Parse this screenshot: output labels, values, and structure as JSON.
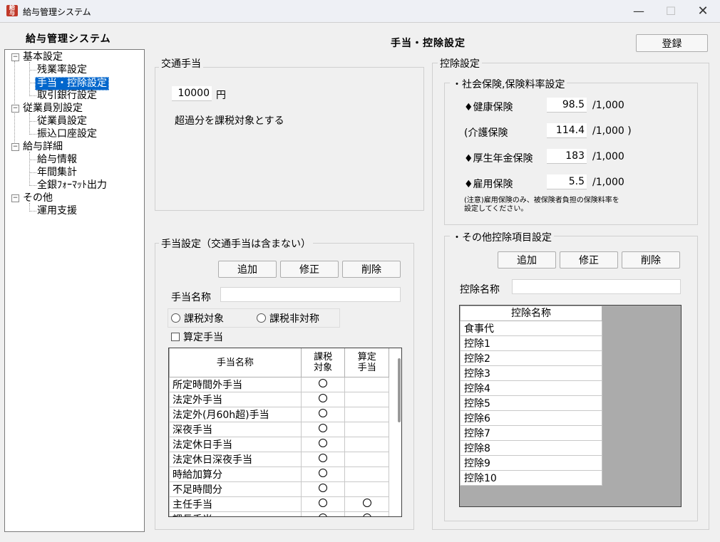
{
  "window": {
    "title": "給与管理システム"
  },
  "sidebar": {
    "app_heading": "給与管理システム",
    "tree": [
      {
        "label": "基本設定",
        "children": [
          "残業率設定",
          "手当・控除設定",
          "取引銀行設定"
        ]
      },
      {
        "label": "従業員別設定",
        "children": [
          "従業員設定",
          "振込口座設定"
        ]
      },
      {
        "label": "給与詳細",
        "children": [
          "給与情報",
          "年間集計",
          "全銀ﾌｫｰﾏｯﾄ出力"
        ]
      },
      {
        "label": "その他",
        "children": [
          "運用支援"
        ]
      }
    ],
    "selected": "手当・控除設定"
  },
  "page": {
    "title": "手当・控除設定",
    "register_label": "登録"
  },
  "commute": {
    "legend": "交通手当",
    "amount": "10000",
    "unit": "円",
    "note": "超過分を課税対象とする"
  },
  "allowance": {
    "legend": "手当設定（交通手当は含まない）",
    "add_label": "追加",
    "edit_label": "修正",
    "delete_label": "削除",
    "name_label": "手当名称",
    "name_value": "",
    "taxable_label": "課税対象",
    "nontaxable_label": "課税非対称",
    "calc_label": "算定手当",
    "columns": [
      "手当名称",
      "課税\n対象",
      "算定\n手当"
    ],
    "rows": [
      {
        "name": "所定時間外手当",
        "taxable": true,
        "calc": false
      },
      {
        "name": "法定外手当",
        "taxable": true,
        "calc": false
      },
      {
        "name": "法定外(月60h超)手当",
        "taxable": true,
        "calc": false
      },
      {
        "name": "深夜手当",
        "taxable": true,
        "calc": false
      },
      {
        "name": "法定休日手当",
        "taxable": true,
        "calc": false
      },
      {
        "name": "法定休日深夜手当",
        "taxable": true,
        "calc": false
      },
      {
        "name": "時給加算分",
        "taxable": true,
        "calc": false
      },
      {
        "name": "不足時間分",
        "taxable": true,
        "calc": false
      },
      {
        "name": "主任手当",
        "taxable": true,
        "calc": true
      },
      {
        "name": "課長手当",
        "taxable": true,
        "calc": true
      }
    ]
  },
  "deduction": {
    "legend": "控除設定",
    "insurance": {
      "legend": "・社会保険,保険料率設定",
      "items": [
        {
          "label": "♦健康保険",
          "value": "98.5",
          "unit": "/1,000"
        },
        {
          "label": "(介護保険",
          "value": "114.4",
          "unit": "/1,000 )"
        },
        {
          "label": "♦厚生年金保険",
          "value": "183",
          "unit": "/1,000"
        },
        {
          "label": "♦雇用保険",
          "value": "5.5",
          "unit": "/1,000"
        }
      ],
      "note_line1": "(注意)雇用保険のみ、被保険者負担の保険料率を",
      "note_line2": "設定してください。"
    },
    "other": {
      "legend": "・その他控除項目設定",
      "add_label": "追加",
      "edit_label": "修正",
      "delete_label": "削除",
      "name_label": "控除名称",
      "name_value": "",
      "column": "控除名称",
      "rows": [
        "食事代",
        "控除1",
        "控除2",
        "控除3",
        "控除4",
        "控除5",
        "控除6",
        "控除7",
        "控除8",
        "控除9",
        "控除10"
      ]
    }
  }
}
